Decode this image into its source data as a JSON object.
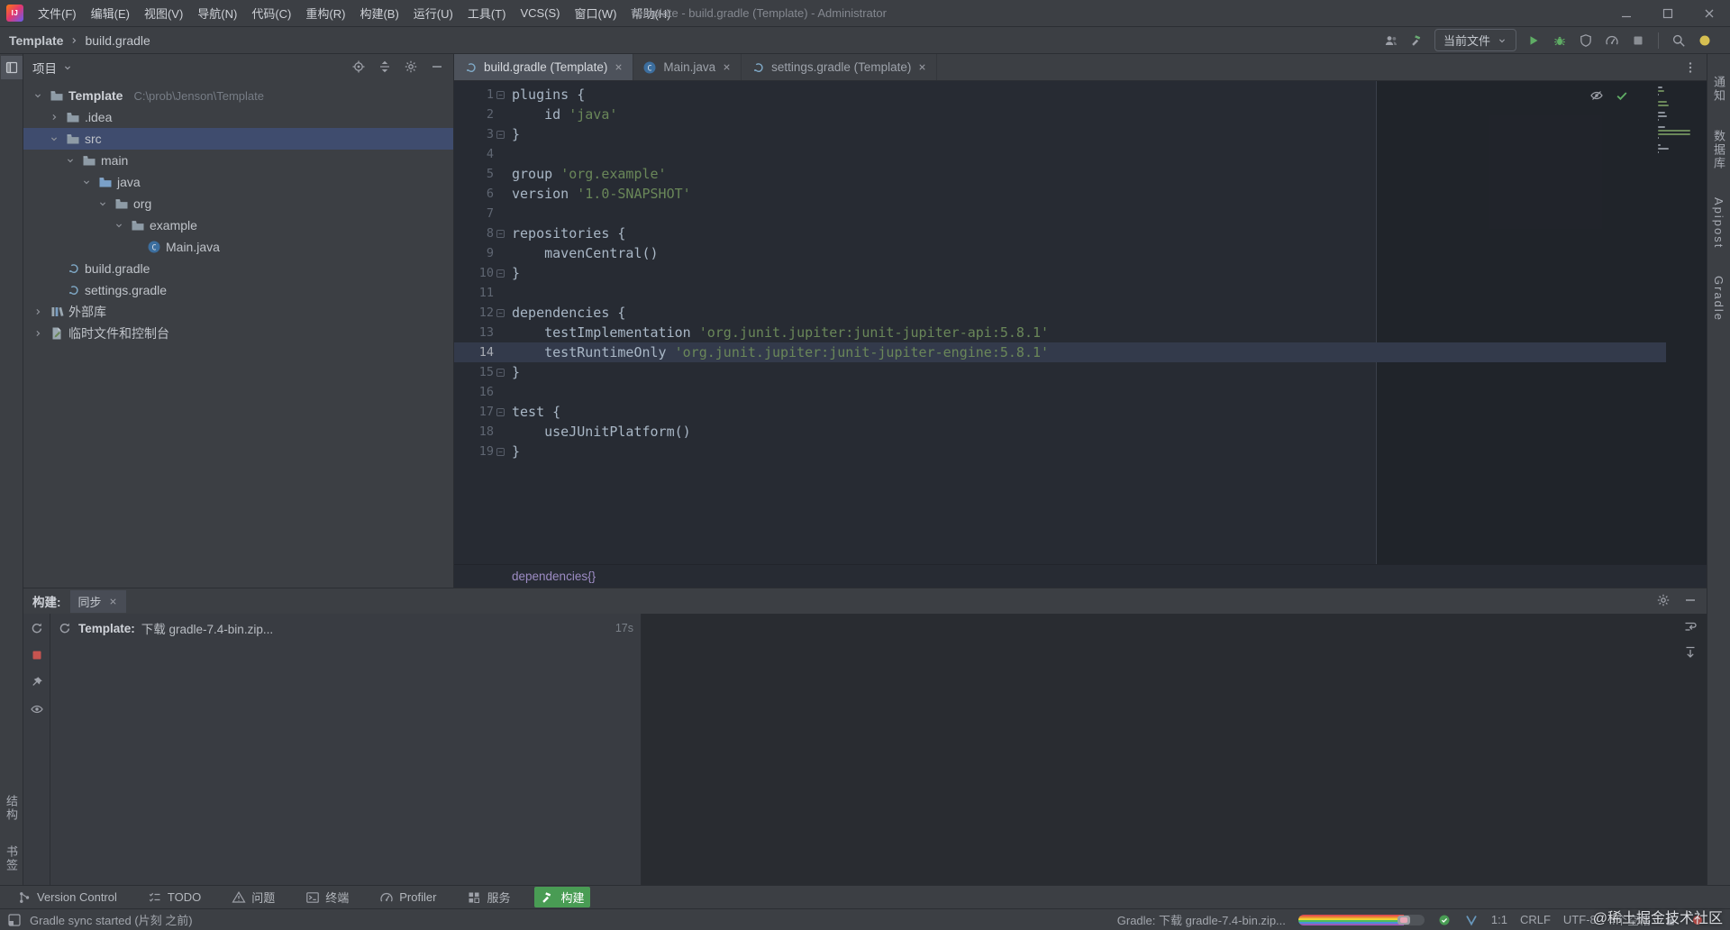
{
  "window": {
    "title": "Template - build.gradle (Template) - Administrator",
    "logo": "IJ"
  },
  "menubar": [
    "文件(F)",
    "编辑(E)",
    "视图(V)",
    "导航(N)",
    "代码(C)",
    "重构(R)",
    "构建(B)",
    "运行(U)",
    "工具(T)",
    "VCS(S)",
    "窗口(W)",
    "帮助(H)"
  ],
  "navbar": {
    "breadcrumbs": [
      "Template",
      "build.gradle"
    ],
    "run_config_label": "当前文件",
    "toolbar": [
      {
        "icon": "users",
        "name": "code-with-me-button"
      },
      {
        "icon": "hammer",
        "name": "build-project-button"
      },
      {
        "type": "combo",
        "label": "当前文件",
        "name": "run-config-combo"
      },
      {
        "icon": "play",
        "name": "run-button"
      },
      {
        "icon": "bug",
        "name": "debug-button"
      },
      {
        "icon": "shield",
        "name": "coverage-button"
      },
      {
        "icon": "profiler",
        "name": "profiler-button"
      },
      {
        "icon": "stop",
        "name": "stop-button"
      },
      {
        "type": "sep"
      },
      {
        "icon": "search",
        "name": "search-everywhere-button"
      },
      {
        "icon": "status-dot",
        "name": "ide-status-button"
      }
    ]
  },
  "left_stripe": {
    "bottom_labels": [
      "结构",
      "书签"
    ]
  },
  "right_stripe": {
    "labels": [
      "通知",
      "数据库",
      "Apipost",
      "Gradle"
    ]
  },
  "project_panel": {
    "title": "项目",
    "header_icons": [
      {
        "icon": "locate",
        "name": "locate-file-button"
      },
      {
        "icon": "collapse-all",
        "name": "collapse-all-button"
      },
      {
        "icon": "gear",
        "name": "panel-options-button"
      },
      {
        "icon": "minus",
        "name": "hide-panel-button"
      }
    ],
    "tree": [
      {
        "label": "Template",
        "path": "C:\\prob\\Jenson\\Template",
        "icon": "folder",
        "depth": 0,
        "twisty": "open",
        "bold": true
      },
      {
        "label": ".idea",
        "icon": "folder",
        "depth": 1,
        "twisty": "closed"
      },
      {
        "label": "src",
        "icon": "folder",
        "depth": 1,
        "twisty": "open",
        "selected": true
      },
      {
        "label": "main",
        "icon": "folder",
        "depth": 2,
        "twisty": "open"
      },
      {
        "label": "java",
        "icon": "src-folder",
        "depth": 3,
        "twisty": "open"
      },
      {
        "label": "org",
        "icon": "folder",
        "depth": 4,
        "twisty": "open"
      },
      {
        "label": "example",
        "icon": "folder",
        "depth": 5,
        "twisty": "open"
      },
      {
        "label": "Main.java",
        "icon": "class",
        "depth": 6,
        "twisty": null
      },
      {
        "label": "build.gradle",
        "icon": "gradle",
        "depth": 1,
        "twisty": null
      },
      {
        "label": "settings.gradle",
        "icon": "gradle",
        "depth": 1,
        "twisty": null
      },
      {
        "label": "外部库",
        "icon": "libraries",
        "depth": 0,
        "twisty": "closed"
      },
      {
        "label": "临时文件和控制台",
        "icon": "scratches",
        "depth": 0,
        "twisty": "closed"
      }
    ]
  },
  "editor": {
    "tabs": [
      {
        "label": "build.gradle (Template)",
        "icon": "gradle",
        "active": true
      },
      {
        "label": "Main.java",
        "icon": "class",
        "active": false
      },
      {
        "label": "settings.gradle (Template)",
        "icon": "gradle",
        "active": false
      }
    ],
    "breadcrumb": "dependencies{}",
    "lines": [
      {
        "n": 1,
        "fold": true,
        "segs": [
          [
            "plugins {",
            "plain"
          ]
        ]
      },
      {
        "n": 2,
        "segs": [
          [
            "    id ",
            "plain"
          ],
          [
            "'java'",
            "string"
          ]
        ]
      },
      {
        "n": 3,
        "fold": true,
        "segs": [
          [
            "}",
            "plain"
          ]
        ]
      },
      {
        "n": 4,
        "segs": []
      },
      {
        "n": 5,
        "segs": [
          [
            "group ",
            "plain"
          ],
          [
            "'org.example'",
            "string"
          ]
        ]
      },
      {
        "n": 6,
        "segs": [
          [
            "version ",
            "plain"
          ],
          [
            "'1.0-SNAPSHOT'",
            "string"
          ]
        ]
      },
      {
        "n": 7,
        "segs": []
      },
      {
        "n": 8,
        "fold": true,
        "segs": [
          [
            "repositories {",
            "plain"
          ]
        ]
      },
      {
        "n": 9,
        "segs": [
          [
            "    mavenCentral()",
            "plain"
          ]
        ]
      },
      {
        "n": 10,
        "fold": true,
        "segs": [
          [
            "}",
            "plain"
          ]
        ]
      },
      {
        "n": 11,
        "segs": []
      },
      {
        "n": 12,
        "fold": true,
        "segs": [
          [
            "dependencies {",
            "plain"
          ]
        ]
      },
      {
        "n": 13,
        "segs": [
          [
            "    testImplementation ",
            "plain"
          ],
          [
            "'org.junit.jupiter:junit-jupiter-api:5.8.1'",
            "string"
          ]
        ]
      },
      {
        "n": 14,
        "current": true,
        "segs": [
          [
            "    testRuntimeOnly ",
            "plain"
          ],
          [
            "'org.junit.jupiter:junit-jupiter-engine:5.8.1'",
            "string"
          ]
        ]
      },
      {
        "n": 15,
        "fold": true,
        "segs": [
          [
            "}",
            "plain"
          ]
        ]
      },
      {
        "n": 16,
        "segs": []
      },
      {
        "n": 17,
        "fold": true,
        "segs": [
          [
            "test {",
            "plain"
          ]
        ]
      },
      {
        "n": 18,
        "segs": [
          [
            "    useJUnitPlatform()",
            "plain"
          ]
        ]
      },
      {
        "n": 19,
        "fold": true,
        "segs": [
          [
            "}",
            "plain"
          ]
        ]
      }
    ]
  },
  "build_panel": {
    "label": "构建:",
    "tab": "同步",
    "left_icons": [
      {
        "icon": "refresh",
        "name": "rerun-sync-button"
      },
      {
        "icon": "stop-red",
        "name": "stop-build-button"
      },
      {
        "icon": "pin",
        "name": "pin-button"
      },
      {
        "icon": "eye",
        "name": "view-options-button"
      }
    ],
    "header_icons": [
      {
        "icon": "gear",
        "name": "build-options-button"
      },
      {
        "icon": "minus",
        "name": "hide-build-panel-button"
      }
    ],
    "console_icons": [
      {
        "icon": "softwrap",
        "name": "soft-wrap-button"
      },
      {
        "icon": "scroll-end",
        "name": "scroll-to-end-button"
      }
    ],
    "row": {
      "prefix": "Template:",
      "message": "下载 gradle-7.4-bin.zip...",
      "elapsed": "17s"
    }
  },
  "bottom_stripe": [
    {
      "label": "Version Control",
      "icon": "vcs"
    },
    {
      "label": "TODO",
      "icon": "todo"
    },
    {
      "label": "问题",
      "icon": "warning"
    },
    {
      "label": "终端",
      "icon": "terminal"
    },
    {
      "label": "Profiler",
      "icon": "profiler"
    },
    {
      "label": "服务",
      "icon": "services"
    },
    {
      "label": "构建",
      "icon": "hammer-white",
      "active": true
    }
  ],
  "statusbar": {
    "left": "Gradle sync started (片刻 之前)",
    "gradle_task": "Gradle: 下载 gradle-7.4-bin.zip...",
    "progress_percent": 84,
    "caret": "1:1",
    "line_sep": "CRLF",
    "encoding": "UTF-8",
    "indent": "4个空格",
    "watermark": "@稀土掘金技术社区"
  },
  "colors": {
    "accent_green": "#499C54",
    "string_green": "#6A8759",
    "selection_blue": "#3F4C6E",
    "caret_line": "#333A4B"
  }
}
